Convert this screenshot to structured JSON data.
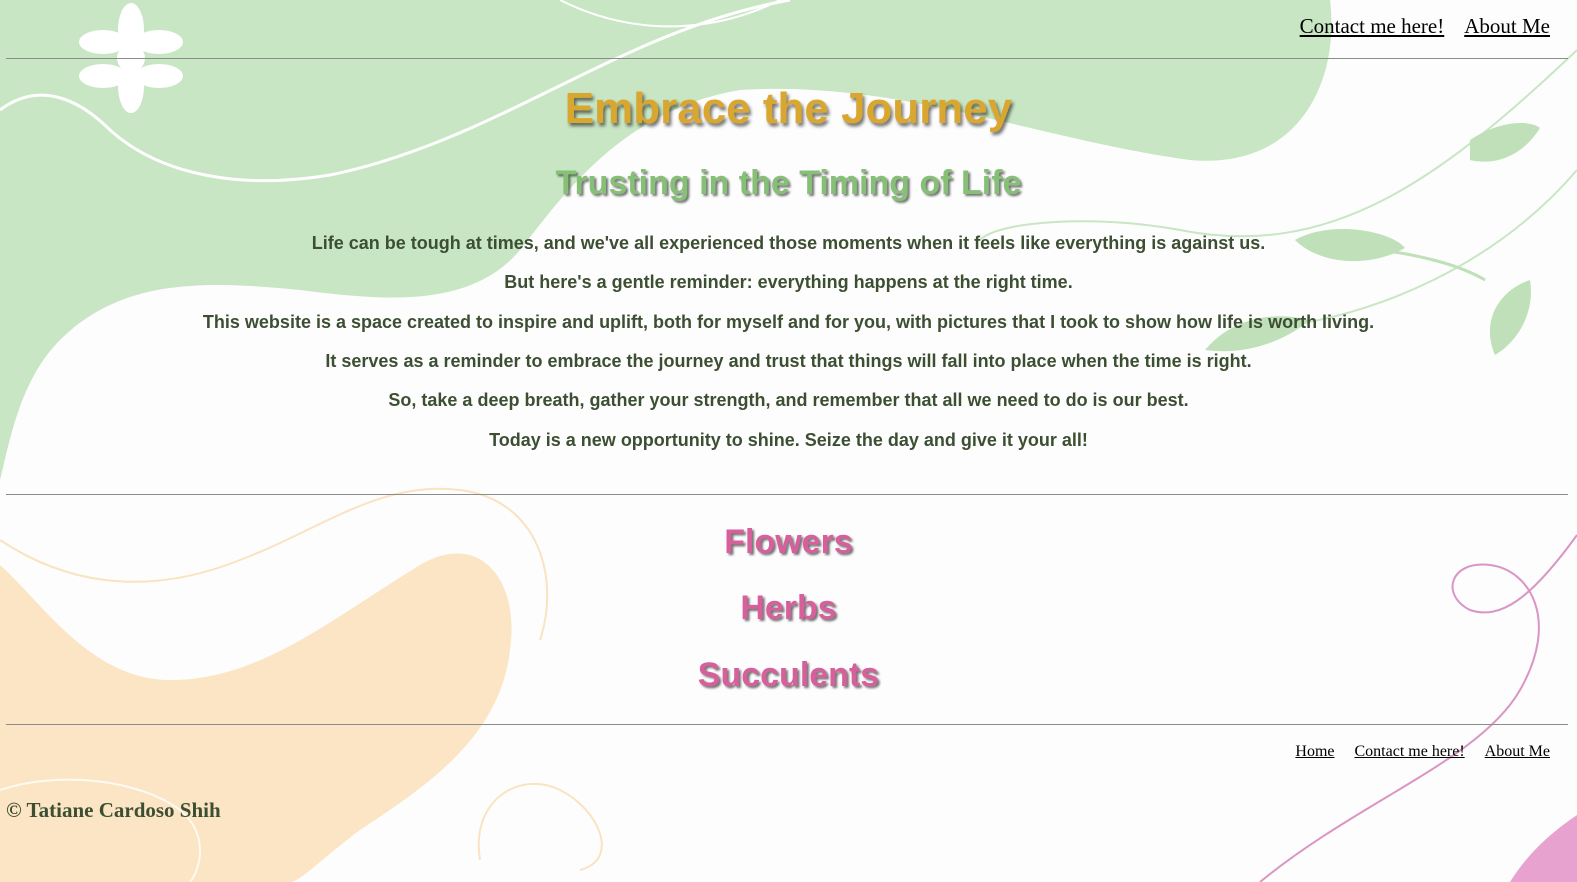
{
  "header": {
    "nav": [
      "Contact me here!",
      "About Me"
    ]
  },
  "hero": {
    "title": "Embrace the Journey",
    "subtitle": "Trusting in the Timing of Life",
    "paragraphs": [
      "Life can be tough at times, and we've all experienced those moments when it feels like everything is against us.",
      "But here's a gentle reminder: everything happens at the right time.",
      "This website is a space created to inspire and uplift, both for myself and for you, with pictures that I took to show how life is worth living.",
      "It serves as a reminder to embrace the journey and trust that things will fall into place when the time is right.",
      "So, take a deep breath, gather your strength, and remember that all we need to do is our best.",
      "Today is a new opportunity to shine. Seize the day and give it your all!"
    ]
  },
  "categories": [
    "Flowers",
    "Herbs",
    "Succulents"
  ],
  "footer": {
    "nav": [
      "Home",
      "Contact me here!",
      "About Me"
    ],
    "copyright": "© Tatiane Cardoso Shih"
  },
  "colors": {
    "title": "#d9a630",
    "subtitle": "#86bf76",
    "text": "#3d4f33",
    "category": "#d65f9c",
    "background_green": "#c8e6c4",
    "background_peach": "#fbe5c4",
    "background_pink": "#e7a2cf"
  },
  "icons": [
    "daisy-flower-icon",
    "leaf-vine-icon"
  ]
}
